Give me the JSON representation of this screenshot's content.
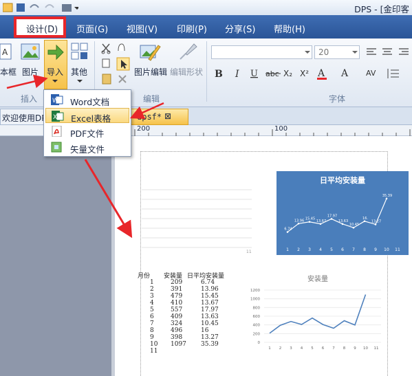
{
  "app": {
    "title": "DPS - [金印客",
    "menu": [
      "设计(D)",
      "页面(G)",
      "视图(V)",
      "印刷(P)",
      "分享(S)",
      "帮助(H)"
    ]
  },
  "ribbon": {
    "buttons": [
      "本框",
      "图片",
      "导入",
      "其他",
      "图片编辑",
      "编辑形状"
    ],
    "groups": [
      "插入",
      "编辑",
      "字体"
    ],
    "font_size": "20"
  },
  "tabs": {
    "welcome": "欢迎使用DP",
    "doc": "dpsf*",
    "close": "⊠"
  },
  "ruler": {
    "t200": "200",
    "t100": "100"
  },
  "dropdown": {
    "items": [
      "Word文档",
      "Excel表格",
      "PDF文件",
      "矢量文件"
    ]
  },
  "chart_data": [
    {
      "type": "line",
      "title": "日平均安装量",
      "categories": [
        "1",
        "2",
        "3",
        "4",
        "5",
        "6",
        "7",
        "8",
        "9",
        "10",
        "11"
      ],
      "values": [
        6.74,
        13.96,
        15.45,
        13.67,
        17.97,
        13.63,
        10.45,
        16,
        13.27,
        35.39,
        null
      ],
      "labels": [
        "6.74",
        "13.96",
        "15.45",
        "13.67",
        "17.97",
        "13.63",
        "10.45",
        "16.",
        "13.27",
        "35.39"
      ]
    },
    {
      "type": "line",
      "title": "安装量",
      "categories": [
        "1",
        "2",
        "3",
        "4",
        "5",
        "6",
        "7",
        "8",
        "9",
        "10",
        "11"
      ],
      "values": [
        209,
        391,
        479,
        410,
        557,
        409,
        324,
        496,
        398,
        1097,
        null
      ],
      "yticks": [
        "0",
        "200",
        "400",
        "600",
        "800",
        "1000",
        "1200"
      ],
      "ylim": [
        0,
        1200
      ]
    }
  ],
  "table": {
    "headers": [
      "月份",
      "安装量",
      "日平均安装量"
    ],
    "rows": [
      [
        "1",
        "209",
        "6.74"
      ],
      [
        "2",
        "391",
        "13.96"
      ],
      [
        "3",
        "479",
        "15.45"
      ],
      [
        "4",
        "410",
        "13.67"
      ],
      [
        "5",
        "557",
        "17.97"
      ],
      [
        "6",
        "409",
        "13.63"
      ],
      [
        "7",
        "324",
        "10.45"
      ],
      [
        "8",
        "496",
        "16"
      ],
      [
        "9",
        "398",
        "13.27"
      ],
      [
        "10",
        "1097",
        "35.39"
      ],
      [
        "11",
        "",
        ""
      ]
    ]
  },
  "colors": {
    "accent": "#e8262a",
    "blue_chart": "#4a7ebb",
    "line": "#4f81bd"
  }
}
